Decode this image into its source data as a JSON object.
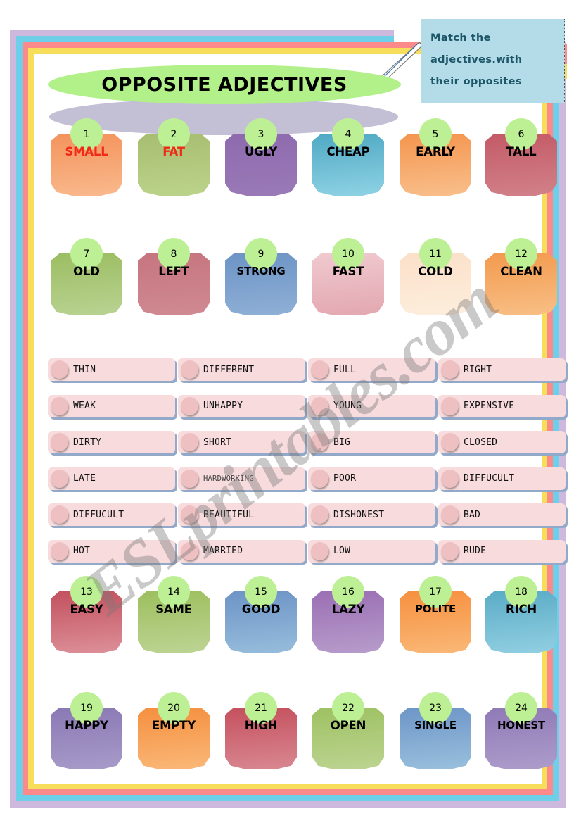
{
  "page": {
    "title": "OPPOSITE ADJECTIVES",
    "watermark": "ESLprintables.com"
  },
  "instructions": {
    "line1": "Match the",
    "line2": "adjectives.with",
    "line3": "their opposites"
  },
  "colors": {
    "frame_outer": "#cdb9dd",
    "frame_blue": "#6ed0e8",
    "frame_pink": "#fc8a8a",
    "frame_yellow": "#f6de5a",
    "title_ellipse": "#b2f08a",
    "title_shadow": "#c3bfd4",
    "number_badge": "#bdf094",
    "instruction_card": "#b3dce8",
    "instruction_text": "#1d5668",
    "bank_item": "#f7dbdd",
    "bank_bullet": "#eec0c2",
    "bank_shadow": "#93a9c9",
    "red_label": "#ef2b18"
  },
  "tag_rows": [
    {
      "row": 1,
      "tags": [
        {
          "num": "1",
          "label": "SMALL",
          "text_color": "red",
          "grad_from": "#f4935c",
          "grad_to": "#f9b98d"
        },
        {
          "num": "2",
          "label": "FAT",
          "text_color": "red",
          "grad_from": "#a7bd70",
          "grad_to": "#bcd38b"
        },
        {
          "num": "3",
          "label": "UGLY",
          "text_color": "black",
          "grad_from": "#8d6aae",
          "grad_to": "#9b7ab8"
        },
        {
          "num": "4",
          "label": "CHEAP",
          "text_color": "black",
          "grad_from": "#4fa9c4",
          "grad_to": "#8fd2e4"
        },
        {
          "num": "5",
          "label": "EARLY",
          "text_color": "black",
          "grad_from": "#f4954e",
          "grad_to": "#f9bf8c"
        },
        {
          "num": "6",
          "label": "TALL",
          "text_color": "black",
          "grad_from": "#c35a66",
          "grad_to": "#d2818a"
        }
      ]
    },
    {
      "row": 2,
      "tags": [
        {
          "num": "7",
          "label": "OLD",
          "text_color": "black",
          "grad_from": "#9cbd62",
          "grad_to": "#b9d392"
        },
        {
          "num": "8",
          "label": "LEFT",
          "text_color": "black",
          "grad_from": "#c6757f",
          "grad_to": "#d08a92"
        },
        {
          "num": "9",
          "label": "STRONG",
          "text_color": "black",
          "grad_from": "#6d94c6",
          "grad_to": "#8fb0d6"
        },
        {
          "num": "10",
          "label": "FAST",
          "text_color": "black",
          "grad_from": "#f0c9cf",
          "grad_to": "#e3a7b0"
        },
        {
          "num": "11",
          "label": "COLD",
          "text_color": "black",
          "grad_from": "#fbe0c9",
          "grad_to": "#fdeedd"
        },
        {
          "num": "12",
          "label": "CLEAN",
          "text_color": "black",
          "grad_from": "#f39a4e",
          "grad_to": "#f8bf86"
        }
      ]
    },
    {
      "row": 3,
      "tags": [
        {
          "num": "13",
          "label": "EASY",
          "text_color": "black",
          "grad_from": "#c2515e",
          "grad_to": "#dd9099"
        },
        {
          "num": "14",
          "label": "SAME",
          "text_color": "black",
          "grad_from": "#9dbf5e",
          "grad_to": "#bdd494"
        },
        {
          "num": "15",
          "label": "GOOD",
          "text_color": "black",
          "grad_from": "#6d94c6",
          "grad_to": "#97bddc"
        },
        {
          "num": "16",
          "label": "LAZY",
          "text_color": "black",
          "grad_from": "#9b6fb4",
          "grad_to": "#b79ccb"
        },
        {
          "num": "17",
          "label": "POLITE",
          "text_color": "black",
          "grad_from": "#f6903f",
          "grad_to": "#fab877"
        },
        {
          "num": "18",
          "label": "RICH",
          "text_color": "black",
          "grad_from": "#5aacc6",
          "grad_to": "#92cfe2"
        }
      ]
    },
    {
      "row": 4,
      "tags": [
        {
          "num": "19",
          "label": "HAPPY",
          "text_color": "black",
          "grad_from": "#8a78b4",
          "grad_to": "#a89bc9"
        },
        {
          "num": "20",
          "label": "EMPTY",
          "text_color": "black",
          "grad_from": "#f58f3f",
          "grad_to": "#fab878"
        },
        {
          "num": "21",
          "label": "HIGH",
          "text_color": "black",
          "grad_from": "#c4505d",
          "grad_to": "#d98892"
        },
        {
          "num": "22",
          "label": "OPEN",
          "text_color": "black",
          "grad_from": "#9ec162",
          "grad_to": "#bcd491"
        },
        {
          "num": "23",
          "label": "SINGLE",
          "text_color": "black",
          "grad_from": "#6d95c7",
          "grad_to": "#9ac0dd"
        },
        {
          "num": "24",
          "label": "HONEST",
          "text_color": "black",
          "grad_from": "#8f7ab6",
          "grad_to": "#ad9ccb"
        }
      ]
    }
  ],
  "word_bank": {
    "columns": [
      [
        "THIN",
        "WEAK",
        "DIRTY",
        "LATE",
        "DIFFUCULT",
        "HOT"
      ],
      [
        "DIFFERENT",
        "UNHAPPY",
        "SHORT",
        "HARDWORKING",
        "BEAUTIFUL",
        "MARRIED"
      ],
      [
        "FULL",
        "YOUNG",
        "BIG",
        "POOR",
        "DISHONEST",
        "LOW"
      ],
      [
        "RIGHT",
        "EXPENSIVE",
        "CLOSED",
        "DIFFUCULT",
        "BAD",
        "RUDE"
      ]
    ]
  }
}
